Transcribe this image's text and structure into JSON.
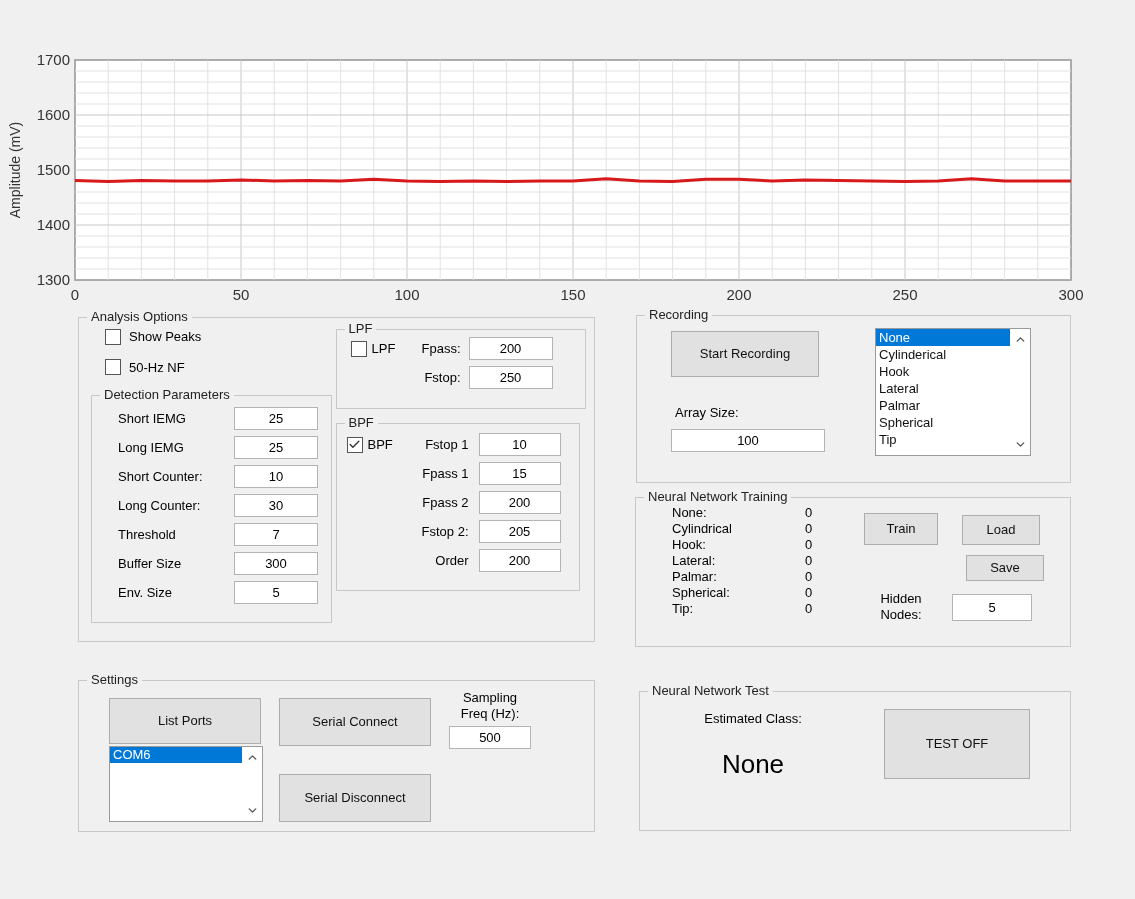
{
  "chart": {
    "chart_data": {
      "type": "line",
      "ylabel": "Amplitude (mV)",
      "x": [
        0,
        10,
        20,
        30,
        40,
        50,
        60,
        70,
        80,
        90,
        100,
        110,
        120,
        130,
        140,
        150,
        160,
        170,
        180,
        190,
        200,
        210,
        220,
        230,
        240,
        250,
        260,
        270,
        280,
        290,
        300
      ],
      "grid": true,
      "series": [
        {
          "color": "#d7191c",
          "values": [
            1481,
            1479,
            1481,
            1480,
            1480,
            1482,
            1480,
            1481,
            1480,
            1483,
            1480,
            1479,
            1480,
            1479,
            1480,
            1480,
            1484,
            1480,
            1479,
            1483,
            1483,
            1480,
            1482,
            1481,
            1480,
            1479,
            1480,
            1484,
            1480,
            1480,
            1480
          ]
        }
      ],
      "xlim": [
        0,
        300
      ],
      "ylim": [
        1300,
        1700
      ],
      "xticks": [
        0,
        50,
        100,
        150,
        200,
        250,
        300
      ],
      "yticks": [
        1300,
        1400,
        1500,
        1600,
        1700
      ]
    }
  },
  "analysis_options": {
    "title": "Analysis Options",
    "checkboxes": [
      {
        "label": "Show Peaks",
        "checked": false
      },
      {
        "label": "50-Hz NF",
        "checked": false
      }
    ],
    "detection_parameters": {
      "title": "Detection Parameters",
      "fields": [
        {
          "label": "Short IEMG",
          "value": "25"
        },
        {
          "label": "Long IEMG",
          "value": "25"
        },
        {
          "label": "Short Counter:",
          "value": "10"
        },
        {
          "label": "Long Counter:",
          "value": "30"
        },
        {
          "label": "Threshold",
          "value": "7"
        },
        {
          "label": "Buffer Size",
          "value": "300"
        },
        {
          "label": "Env. Size",
          "value": "5"
        }
      ]
    },
    "lpf": {
      "title": "LPF",
      "checkbox": {
        "label": "LPF",
        "checked": false
      },
      "fields": [
        {
          "label": "Fpass:",
          "value": "200"
        },
        {
          "label": "Fstop:",
          "value": "250"
        }
      ]
    },
    "bpf": {
      "title": "BPF",
      "checkbox": {
        "label": "BPF",
        "checked": true
      },
      "fields": [
        {
          "label": "Fstop 1",
          "value": "10"
        },
        {
          "label": "Fpass 1",
          "value": "15"
        },
        {
          "label": "Fpass 2",
          "value": "200"
        },
        {
          "label": "Fstop 2:",
          "value": "205"
        },
        {
          "label": "Order",
          "value": "200"
        }
      ]
    }
  },
  "recording": {
    "title": "Recording",
    "start_button": "Start Recording",
    "array_size_label": "Array Size:",
    "array_size_value": "100",
    "classes": [
      {
        "label": "None",
        "selected": true
      },
      {
        "label": "Cylinderical",
        "selected": false
      },
      {
        "label": "Hook",
        "selected": false
      },
      {
        "label": "Lateral",
        "selected": false
      },
      {
        "label": "Palmar",
        "selected": false
      },
      {
        "label": "Spherical",
        "selected": false
      },
      {
        "label": "Tip",
        "selected": false
      }
    ]
  },
  "training": {
    "title": "Neural Network Training",
    "counts": [
      {
        "label": "None:",
        "value": "0"
      },
      {
        "label": "Cylindrical",
        "value": "0"
      },
      {
        "label": "Hook:",
        "value": "0"
      },
      {
        "label": "Lateral:",
        "value": "0"
      },
      {
        "label": "Palmar:",
        "value": "0"
      },
      {
        "label": "Spherical:",
        "value": "0"
      },
      {
        "label": "Tip:",
        "value": "0"
      }
    ],
    "train_button": "Train",
    "load_button": "Load",
    "save_button": "Save",
    "hidden_nodes_label": "Hidden Nodes:",
    "hidden_nodes_value": "5"
  },
  "settings": {
    "title": "Settings",
    "list_ports_button": "List Ports",
    "ports": [
      {
        "label": "COM6",
        "selected": true
      }
    ],
    "connect_button": "Serial Connect",
    "disconnect_button": "Serial Disconnect",
    "sampling_label": "Sampling Freq (Hz):",
    "sampling_value": "500"
  },
  "test": {
    "title": "Neural Network Test",
    "estimated_label": "Estimated Class:",
    "estimated_value": "None",
    "test_button": "TEST OFF"
  }
}
